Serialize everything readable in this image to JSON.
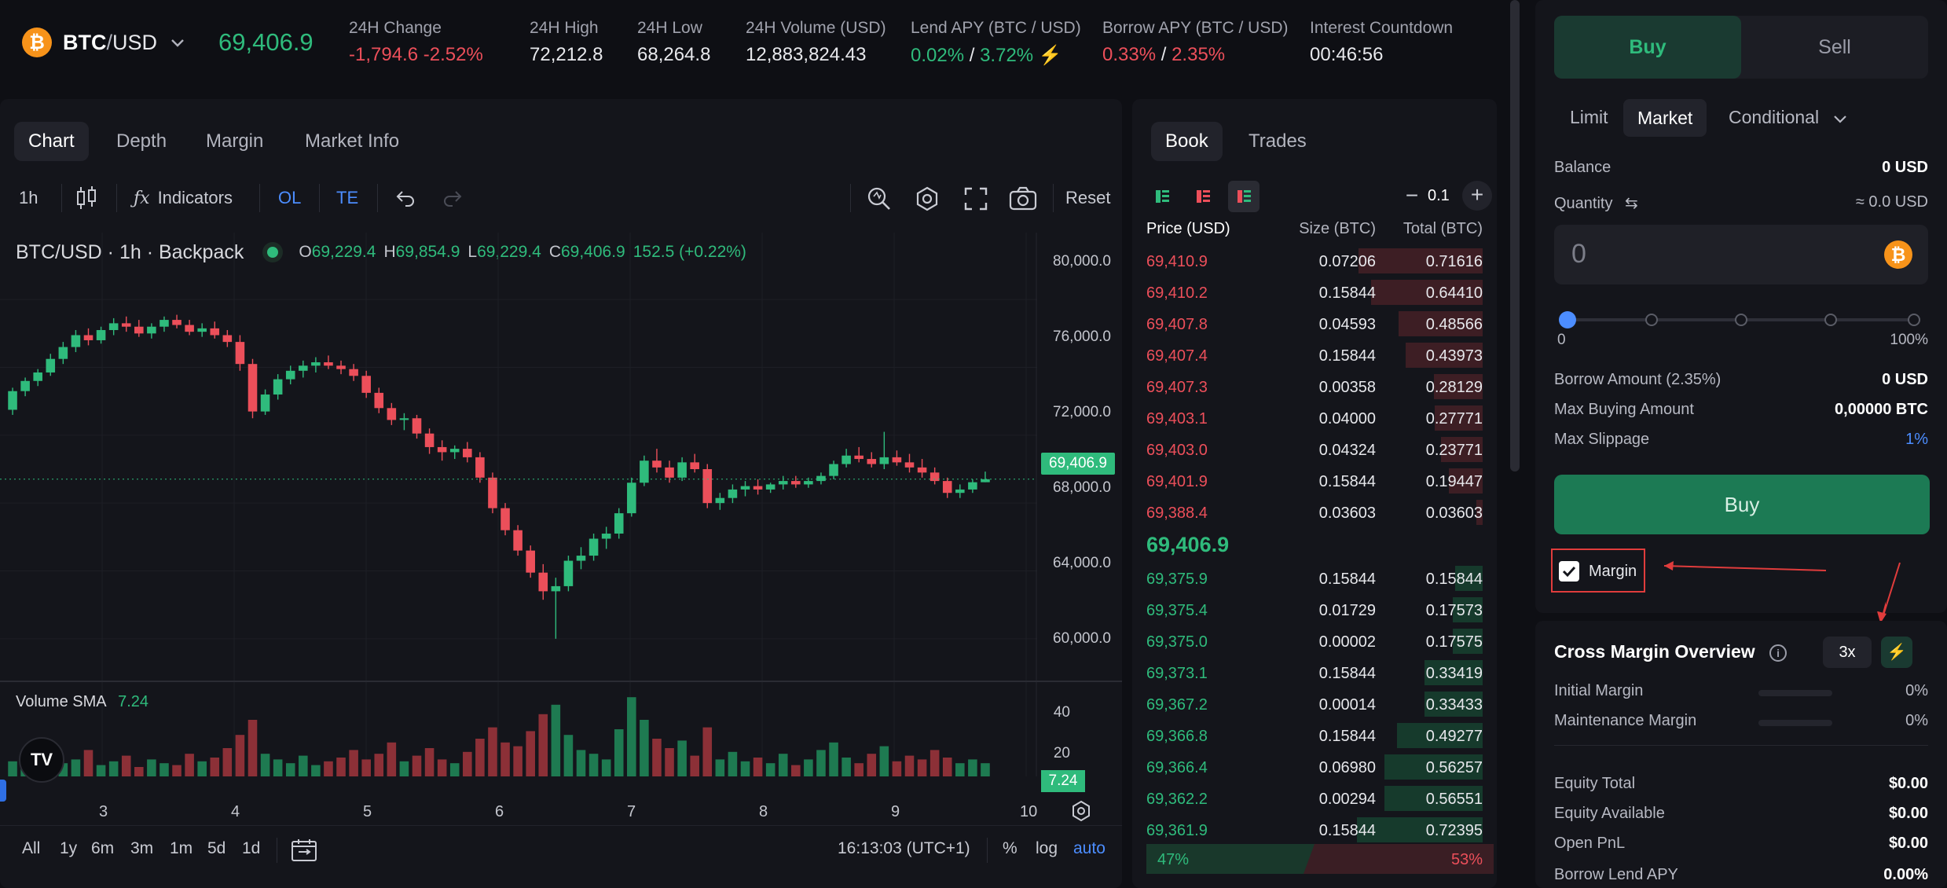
{
  "header": {
    "pair_base": "BTC",
    "pair_sep": "/",
    "pair_quote": "USD",
    "last_price": "69,406.9",
    "change_label": "24H Change",
    "change_abs": "-1,794.6",
    "change_pct": "-2.52%",
    "high_label": "24H High",
    "high_value": "72,212.8",
    "low_label": "24H Low",
    "low_value": "68,264.8",
    "volume_label": "24H Volume (USD)",
    "volume_value": "12,883,824.43",
    "lend_label": "Lend APY (BTC / USD)",
    "lend_btc": "0.02%",
    "lend_sep": "/",
    "lend_usd": "3.72%",
    "borrow_label": "Borrow APY (BTC / USD)",
    "borrow_btc": "0.33%",
    "borrow_sep": "/",
    "borrow_usd": "2.35%",
    "countdown_label": "Interest Countdown",
    "countdown_value": "00:46:56"
  },
  "chart_tabs": [
    "Chart",
    "Depth",
    "Margin",
    "Market Info"
  ],
  "toolbar": {
    "interval": "1h",
    "indicators": "Indicators",
    "ol": "OL",
    "te": "TE",
    "reset": "Reset"
  },
  "legend": {
    "title": "BTC/USD · 1h · Backpack",
    "o_label": "O",
    "o_value": "69,229.4",
    "h_label": "H",
    "h_value": "69,854.9",
    "l_label": "L",
    "l_value": "69,229.4",
    "c_label": "C",
    "c_value": "69,406.9",
    "change": "152.5 (+0.22%)",
    "volume_label": "Volume SMA",
    "volume_value": "7.24"
  },
  "price_axis": [
    "80,000.0",
    "76,000.0",
    "72,000.0",
    "68,000.0",
    "64,000.0",
    "60,000.0"
  ],
  "price_tag": "69,406.9",
  "volume_axis": [
    "40",
    "20"
  ],
  "volume_tag": "7.24",
  "time_axis": [
    "3",
    "4",
    "5",
    "6",
    "7",
    "8",
    "9",
    "10"
  ],
  "ranges": [
    "All",
    "1y",
    "6m",
    "3m",
    "1m",
    "5d",
    "1d"
  ],
  "footer": {
    "clock": "16:13:03 (UTC+1)",
    "pct": "%",
    "log": "log",
    "auto": "auto"
  },
  "chart_data": {
    "type": "candlestick",
    "ylim": [
      58000,
      82000
    ],
    "volume_ylim": [
      0,
      50
    ],
    "candles": [
      [
        73500,
        74800,
        73200,
        74600
      ],
      [
        74600,
        75400,
        74300,
        75200
      ],
      [
        75200,
        75900,
        74900,
        75700
      ],
      [
        75700,
        76800,
        75500,
        76500
      ],
      [
        76500,
        77500,
        76200,
        77200
      ],
      [
        77200,
        78200,
        76900,
        77900
      ],
      [
        77900,
        78300,
        77300,
        77600
      ],
      [
        77600,
        78400,
        77400,
        78200
      ],
      [
        78200,
        78900,
        77900,
        78600
      ],
      [
        78600,
        79000,
        78100,
        78400
      ],
      [
        78400,
        78800,
        77800,
        78000
      ],
      [
        78000,
        78600,
        77700,
        78400
      ],
      [
        78400,
        79000,
        78100,
        78800
      ],
      [
        78800,
        79100,
        78300,
        78500
      ],
      [
        78500,
        78800,
        77900,
        78100
      ],
      [
        78100,
        78600,
        77800,
        78300
      ],
      [
        78300,
        78700,
        77700,
        77900
      ],
      [
        77900,
        78200,
        77200,
        77500
      ],
      [
        77500,
        77900,
        75800,
        76200
      ],
      [
        76200,
        76500,
        73000,
        73400
      ],
      [
        73400,
        74700,
        73200,
        74400
      ],
      [
        74400,
        75600,
        74100,
        75300
      ],
      [
        75300,
        76100,
        75000,
        75800
      ],
      [
        75800,
        76400,
        75400,
        76100
      ],
      [
        76100,
        76600,
        75700,
        76300
      ],
      [
        76300,
        76700,
        75900,
        76100
      ],
      [
        76100,
        76400,
        75600,
        75900
      ],
      [
        75900,
        76200,
        75200,
        75500
      ],
      [
        75500,
        75800,
        74200,
        74500
      ],
      [
        74500,
        74800,
        73300,
        73600
      ],
      [
        73600,
        73900,
        72600,
        72900
      ],
      [
        72900,
        73300,
        72300,
        73000
      ],
      [
        73000,
        73200,
        71800,
        72100
      ],
      [
        72100,
        72400,
        70900,
        71300
      ],
      [
        71300,
        71700,
        70500,
        71000
      ],
      [
        71000,
        71400,
        70600,
        71200
      ],
      [
        71200,
        71600,
        70400,
        70700
      ],
      [
        70700,
        71000,
        69200,
        69500
      ],
      [
        69500,
        69800,
        67400,
        67700
      ],
      [
        67700,
        68000,
        66100,
        66400
      ],
      [
        66400,
        66700,
        64900,
        65200
      ],
      [
        65200,
        65500,
        63600,
        63900
      ],
      [
        63900,
        64400,
        62300,
        62800
      ],
      [
        62800,
        63600,
        60000,
        63100
      ],
      [
        63100,
        64900,
        62800,
        64600
      ],
      [
        64600,
        65400,
        64100,
        64900
      ],
      [
        64900,
        66200,
        64600,
        65900
      ],
      [
        65900,
        66600,
        65300,
        66200
      ],
      [
        66200,
        67700,
        65900,
        67400
      ],
      [
        67400,
        69500,
        67200,
        69200
      ],
      [
        69200,
        70800,
        69000,
        70500
      ],
      [
        70500,
        71200,
        69800,
        70100
      ],
      [
        70100,
        70500,
        69200,
        69500
      ],
      [
        69500,
        70700,
        69300,
        70400
      ],
      [
        70400,
        70900,
        69800,
        70000
      ],
      [
        70000,
        70300,
        67700,
        68000
      ],
      [
        68000,
        68600,
        67600,
        68300
      ],
      [
        68300,
        69100,
        68000,
        68800
      ],
      [
        68800,
        69300,
        68400,
        69000
      ],
      [
        69000,
        69400,
        68500,
        68800
      ],
      [
        68800,
        69200,
        68600,
        69100
      ],
      [
        69100,
        69600,
        68800,
        69300
      ],
      [
        69300,
        69600,
        68900,
        69100
      ],
      [
        69100,
        69500,
        68900,
        69300
      ],
      [
        69300,
        69800,
        69100,
        69600
      ],
      [
        69600,
        70500,
        69400,
        70300
      ],
      [
        70300,
        71200,
        70100,
        70800
      ],
      [
        70800,
        71300,
        70400,
        70600
      ],
      [
        70600,
        71000,
        70100,
        70300
      ],
      [
        70300,
        72200,
        70000,
        70700
      ],
      [
        70700,
        71100,
        70200,
        70400
      ],
      [
        70400,
        70900,
        69800,
        70100
      ],
      [
        70100,
        70600,
        69500,
        69800
      ],
      [
        69800,
        70100,
        69100,
        69300
      ],
      [
        69300,
        69500,
        68300,
        68600
      ],
      [
        68600,
        69100,
        68300,
        68800
      ],
      [
        68800,
        69400,
        68600,
        69229
      ],
      [
        69229,
        69855,
        69229,
        69407
      ]
    ],
    "volumes": [
      8,
      6,
      10,
      12,
      7,
      9,
      14,
      6,
      8,
      11,
      5,
      9,
      7,
      6,
      12,
      8,
      10,
      15,
      22,
      30,
      12,
      9,
      7,
      11,
      6,
      8,
      10,
      14,
      9,
      12,
      18,
      8,
      11,
      15,
      9,
      7,
      13,
      20,
      26,
      18,
      16,
      24,
      33,
      38,
      22,
      14,
      12,
      9,
      25,
      42,
      30,
      20,
      15,
      19,
      11,
      26,
      9,
      13,
      8,
      10,
      7,
      12,
      6,
      9,
      14,
      18,
      10,
      7,
      12,
      16,
      8,
      11,
      9,
      14,
      10,
      7,
      9,
      7
    ]
  },
  "book_tabs": [
    "Book",
    "Trades"
  ],
  "book_step": "0.1",
  "book_headers": [
    "Price (USD)",
    "Size (BTC)",
    "Total (BTC)"
  ],
  "asks": [
    {
      "price": "69,410.9",
      "size": "0.07206",
      "total": "0.71616"
    },
    {
      "price": "69,410.2",
      "size": "0.15844",
      "total": "0.64410"
    },
    {
      "price": "69,407.8",
      "size": "0.04593",
      "total": "0.48566"
    },
    {
      "price": "69,407.4",
      "size": "0.15844",
      "total": "0.43973"
    },
    {
      "price": "69,407.3",
      "size": "0.00358",
      "total": "0.28129"
    },
    {
      "price": "69,403.1",
      "size": "0.04000",
      "total": "0.27771"
    },
    {
      "price": "69,403.0",
      "size": "0.04324",
      "total": "0.23771"
    },
    {
      "price": "69,401.9",
      "size": "0.15844",
      "total": "0.19447"
    },
    {
      "price": "69,388.4",
      "size": "0.03603",
      "total": "0.03603"
    }
  ],
  "ask_depth": [
    0.99,
    0.89,
    0.67,
    0.61,
    0.39,
    0.38,
    0.33,
    0.27,
    0.05
  ],
  "mid_price": "69,406.9",
  "bids": [
    {
      "price": "69,375.9",
      "size": "0.15844",
      "total": "0.15844"
    },
    {
      "price": "69,375.4",
      "size": "0.01729",
      "total": "0.17573"
    },
    {
      "price": "69,375.0",
      "size": "0.00002",
      "total": "0.17575"
    },
    {
      "price": "69,373.1",
      "size": "0.15844",
      "total": "0.33419"
    },
    {
      "price": "69,367.2",
      "size": "0.00014",
      "total": "0.33433"
    },
    {
      "price": "69,366.8",
      "size": "0.15844",
      "total": "0.49277"
    },
    {
      "price": "69,366.4",
      "size": "0.06980",
      "total": "0.56257"
    },
    {
      "price": "69,362.2",
      "size": "0.00294",
      "total": "0.56551"
    },
    {
      "price": "69,361.9",
      "size": "0.15844",
      "total": "0.72395"
    }
  ],
  "bid_depth": [
    0.22,
    0.24,
    0.24,
    0.46,
    0.46,
    0.68,
    0.78,
    0.78,
    1.0
  ],
  "book_ratio": {
    "buy": "47%",
    "sell": "53%",
    "buy_frac": 0.47
  },
  "trade": {
    "buy_tab": "Buy",
    "sell_tab": "Sell",
    "order_types": [
      "Limit",
      "Market",
      "Conditional"
    ],
    "balance_label": "Balance",
    "balance_value": "0 USD",
    "quantity_label": "Quantity",
    "quantity_value": "≈ 0.0 USD",
    "quantity_input": "0",
    "slider_min": "0",
    "slider_max": "100%",
    "slider_value": 0,
    "borrow_label": "Borrow Amount (2.35%)",
    "borrow_value": "0 USD",
    "maxbuy_label": "Max Buying Amount",
    "maxbuy_value": "0,00000 BTC",
    "slippage_label": "Max Slippage",
    "slippage_value": "1%",
    "submit": "Buy",
    "margin_label": "Margin"
  },
  "margin": {
    "title": "Cross Margin Overview",
    "leverage": "3x",
    "initial_label": "Initial Margin",
    "initial_value": "0%",
    "maint_label": "Maintenance Margin",
    "maint_value": "0%",
    "equity_total_label": "Equity Total",
    "equity_total_value": "$0.00",
    "equity_avail_label": "Equity Available",
    "equity_avail_value": "$0.00",
    "pnl_label": "Open PnL",
    "pnl_value": "$0.00",
    "lend_label": "Borrow Lend APY",
    "lend_value": "0.00%"
  },
  "colors": {
    "up": "#2fbb7c",
    "down": "#ec4f5a",
    "accent": "#4c8dff",
    "bg": "#0e0f14",
    "panel": "#14151b"
  }
}
